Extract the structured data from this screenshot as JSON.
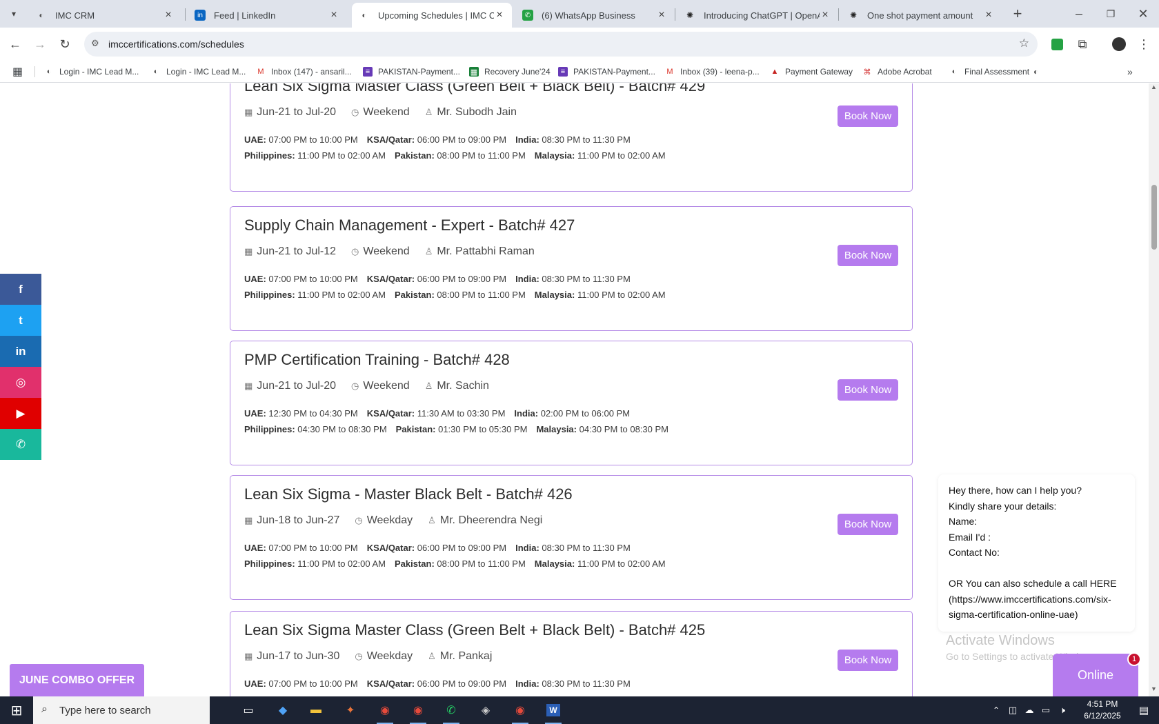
{
  "browser": {
    "tabs": [
      {
        "title": "IMC CRM",
        "icon": "imc-logo-icon",
        "active": false
      },
      {
        "title": "Feed | LinkedIn",
        "icon": "linkedin-icon",
        "active": false
      },
      {
        "title": "Upcoming Schedules | IMC Certi",
        "icon": "imc-logo-icon",
        "active": true
      },
      {
        "title": "(6) WhatsApp Business",
        "icon": "whatsapp-icon",
        "active": false
      },
      {
        "title": "Introducing ChatGPT | OpenAI",
        "icon": "openai-icon",
        "active": false
      },
      {
        "title": "One shot payment amount",
        "icon": "openai-icon",
        "active": false
      }
    ],
    "url": "imccertifications.com/schedules",
    "bookmarks": [
      {
        "label": "Login - IMC Lead M...",
        "icon": "imc-logo-icon"
      },
      {
        "label": "Login - IMC Lead M...",
        "icon": "imc-logo-icon"
      },
      {
        "label": "Inbox (147) - ansaril...",
        "icon": "gmail-icon"
      },
      {
        "label": "PAKISTAN-Payment...",
        "icon": "forms-icon"
      },
      {
        "label": "Recovery June'24",
        "icon": "sheets-icon"
      },
      {
        "label": "PAKISTAN-Payment...",
        "icon": "forms-icon"
      },
      {
        "label": "Inbox (39) - leena-p...",
        "icon": "gmail-icon"
      },
      {
        "label": "Payment Gateway",
        "icon": "payment-icon"
      },
      {
        "label": "Adobe Acrobat",
        "icon": "acrobat-icon"
      },
      {
        "label": "Final Assessment",
        "icon": "imc-logo-icon"
      }
    ]
  },
  "page": {
    "book_label": "Book Now",
    "tz_labels": {
      "uae": "UAE:",
      "ksa": "KSA/Qatar:",
      "india": "India:",
      "philippines": "Philippines:",
      "pakistan": "Pakistan:",
      "malaysia": "Malaysia:"
    },
    "courses": [
      {
        "title": "Lean Six Sigma Master Class (Green Belt + Black Belt) - Batch# 429",
        "dates": "Jun-21 to Jul-20",
        "type": "Weekend",
        "trainer": "Mr. Subodh Jain",
        "uae": "07:00 PM to 10:00 PM",
        "ksa": "06:00 PM to 09:00 PM",
        "india": "08:30 PM to 11:30 PM",
        "philippines": "11:00 PM to 02:00 AM",
        "pakistan": "08:00 PM to 11:00 PM",
        "malaysia": "11:00 PM to 02:00 AM"
      },
      {
        "title": "Supply Chain Management - Expert - Batch# 427",
        "dates": "Jun-21 to Jul-12",
        "type": "Weekend",
        "trainer": "Mr. Pattabhi Raman",
        "uae": "07:00 PM to 10:00 PM",
        "ksa": "06:00 PM to 09:00 PM",
        "india": "08:30 PM to 11:30 PM",
        "philippines": "11:00 PM to 02:00 AM",
        "pakistan": "08:00 PM to 11:00 PM",
        "malaysia": "11:00 PM to 02:00 AM"
      },
      {
        "title": "PMP Certification Training - Batch# 428",
        "dates": "Jun-21 to Jul-20",
        "type": "Weekend",
        "trainer": "Mr. Sachin",
        "uae": "12:30 PM to 04:30 PM",
        "ksa": "11:30 AM to 03:30 PM",
        "india": "02:00 PM to 06:00 PM",
        "philippines": "04:30 PM to 08:30 PM",
        "pakistan": "01:30 PM to 05:30 PM",
        "malaysia": "04:30 PM to 08:30 PM"
      },
      {
        "title": "Lean Six Sigma - Master Black Belt - Batch# 426",
        "dates": "Jun-18 to Jun-27",
        "type": "Weekday",
        "trainer": "Mr. Dheerendra Negi",
        "uae": "07:00 PM to 10:00 PM",
        "ksa": "06:00 PM to 09:00 PM",
        "india": "08:30 PM to 11:30 PM",
        "philippines": "11:00 PM to 02:00 AM",
        "pakistan": "08:00 PM to 11:00 PM",
        "malaysia": "11:00 PM to 02:00 AM"
      },
      {
        "title": "Lean Six Sigma Master Class (Green Belt + Black Belt) - Batch# 425",
        "dates": "Jun-17 to Jun-30",
        "type": "Weekday",
        "trainer": "Mr. Pankaj",
        "uae": "07:00 PM to 10:00 PM",
        "ksa": "06:00 PM to 09:00 PM",
        "india": "08:30 PM to 11:30 PM",
        "philippines": "",
        "pakistan": "",
        "malaysia": ""
      }
    ],
    "social": [
      {
        "icon": "facebook-icon",
        "glyph": "f",
        "color": "#3b5998"
      },
      {
        "icon": "twitter-icon",
        "glyph": "t",
        "color": "#1da1f2"
      },
      {
        "icon": "linkedin-icon",
        "glyph": "in",
        "color": "#1a6bb1"
      },
      {
        "icon": "instagram-icon",
        "glyph": "◎",
        "color": "#e1306c"
      },
      {
        "icon": "youtube-icon",
        "glyph": "▶",
        "color": "#e00000"
      },
      {
        "icon": "whatsapp-icon",
        "glyph": "✆",
        "color": "#19b89c"
      }
    ],
    "combo_offer": "JUNE COMBO OFFER",
    "accent_color": "#b57bee"
  },
  "chat": {
    "lines": [
      "Hey there, how can I help you?",
      "Kindly share your details:",
      "Name:",
      "Email I'd :",
      "Contact No:",
      "",
      "OR You can also schedule a call HERE",
      "(https://www.imccertifications.com/six-",
      "sigma-certification-online-uae)"
    ],
    "status": "Online",
    "badge": "1"
  },
  "watermark": {
    "line1": "Activate Windows",
    "line2": "Go to Settings to activate Windows."
  },
  "taskbar": {
    "search_placeholder": "Type here to search",
    "time": "4:51 PM",
    "date": "6/12/2025"
  }
}
